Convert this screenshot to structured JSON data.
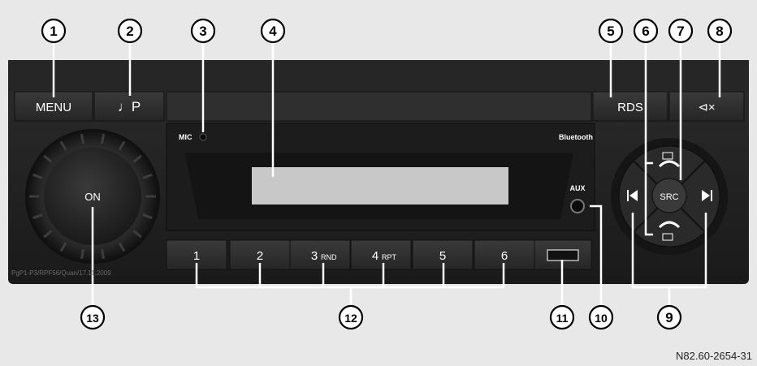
{
  "panel": {
    "menu_label": "MENU",
    "note_label": "♩P",
    "rds_label": "RDS",
    "mute_label": "⊲×",
    "mic_label": "MIC",
    "bluetooth_label": "Bluetooth",
    "aux_label": "AUX",
    "on_label": "ON",
    "src_label": "SRC",
    "serial_text": "PgP1-P3/RPF56/Quan/17.11.2009"
  },
  "presets": [
    {
      "num": "1",
      "sub": ""
    },
    {
      "num": "2",
      "sub": ""
    },
    {
      "num": "3",
      "sub": "RND"
    },
    {
      "num": "4",
      "sub": "RPT"
    },
    {
      "num": "5",
      "sub": ""
    },
    {
      "num": "6",
      "sub": ""
    }
  ],
  "callouts": [
    "1",
    "2",
    "3",
    "4",
    "5",
    "6",
    "7",
    "8",
    "9",
    "10",
    "11",
    "12",
    "13"
  ],
  "figure_code": "N82.60-2654-31"
}
